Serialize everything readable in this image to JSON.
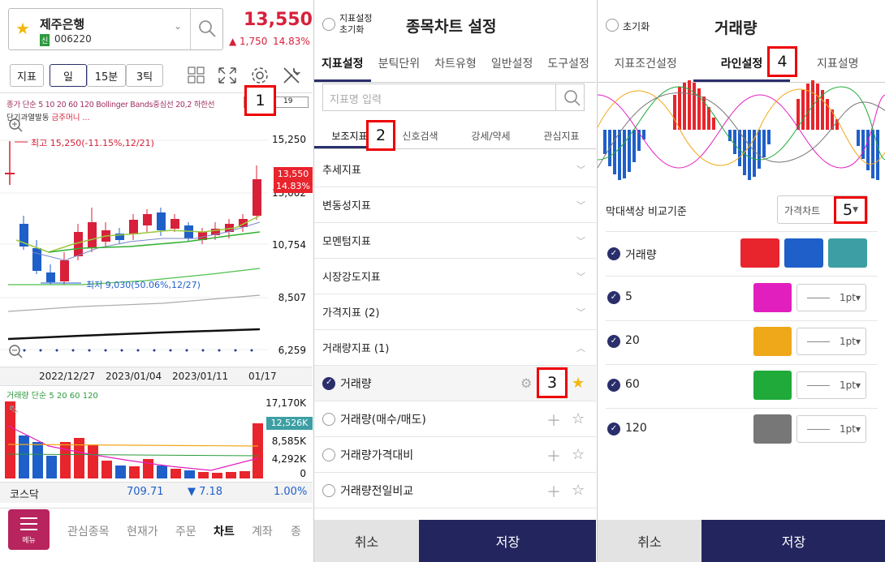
{
  "panel1": {
    "stock_name": "제주은행",
    "stock_badge": "신",
    "stock_code": "006220",
    "price": "13,550",
    "change": "▲ 1,750",
    "change_pct": "14.83%",
    "toolbar": {
      "indicator": "지표",
      "day": "일",
      "min15": "15분",
      "tick3": "3틱"
    },
    "legend_line1": "종가 단순 5 10 20 60 120 Bollinger Bands중심선 20,2 하한선",
    "legend_input_a": "2",
    "legend_input_b": "19",
    "legend_line2_a": "단기과열발동",
    "legend_line2_b": "금주머니 ...",
    "high_label": "최고 15,250(-11.15%,12/21)",
    "low_label": "최저 9,030(50.06%,12/27)",
    "price_axis": [
      "15,250",
      "13,002",
      "10,754",
      "8,507",
      "6,259"
    ],
    "current_price_tag": "13,550",
    "current_pct_tag": "14.83%",
    "dates": [
      "2022/12/27",
      "2023/01/04",
      "2023/01/11",
      "01/17"
    ],
    "volume_legend": "거래량 단순 5 20 60 120",
    "volume_axis": [
      "17,170K",
      "8,585K",
      "4,292K",
      "0"
    ],
    "volume_tag": "12,526K",
    "kospi_name": "코스닥",
    "kospi_value": "709.71",
    "kospi_change": "▼ 7.18",
    "kospi_pct": "1.00%",
    "menu_label": "메뉴",
    "nav": [
      "관심종목",
      "현재가",
      "주문",
      "차트",
      "계좌",
      "종"
    ],
    "marker": "1"
  },
  "panel2": {
    "reset_label": "지표설정 초기화",
    "title": "종목차트 설정",
    "tabs": [
      "지표설정",
      "분틱단위",
      "차트유형",
      "일반설정",
      "도구설정"
    ],
    "search_placeholder": "지표명 입력",
    "subtabs": [
      "보조지표",
      "신호검색",
      "강세/약세",
      "관심지표"
    ],
    "categories": [
      "추세지표",
      "변동성지표",
      "모멘텀지표",
      "시장강도지표",
      "가격지표 (2)",
      "거래량지표 (1)"
    ],
    "items": [
      "거래량",
      "거래량(매수/매도)",
      "거래량가격대비",
      "거래량전일비교"
    ],
    "cancel": "취소",
    "save": "저장",
    "marker2": "2",
    "marker3": "3"
  },
  "panel3": {
    "reset_label": "초기화",
    "title": "거래량",
    "tabs": [
      "지표조건설정",
      "라인설정",
      "지표설명"
    ],
    "bar_color_label": "막대색상 비교기준",
    "bar_color_value": "가격차트",
    "rows": [
      {
        "label": "거래량"
      },
      {
        "label": "5",
        "width": "1pt"
      },
      {
        "label": "20",
        "width": "1pt"
      },
      {
        "label": "60",
        "width": "1pt"
      },
      {
        "label": "120",
        "width": "1pt"
      }
    ],
    "colors": {
      "up": "#e8242c",
      "down": "#1f5fc9",
      "flat": "#3d9fa3",
      "ma5": "#e11fbf",
      "ma20": "#efa81a",
      "ma60": "#1faa3a",
      "ma120": "#777777"
    },
    "cancel": "취소",
    "save": "저장",
    "marker4": "4",
    "marker5": "5"
  }
}
